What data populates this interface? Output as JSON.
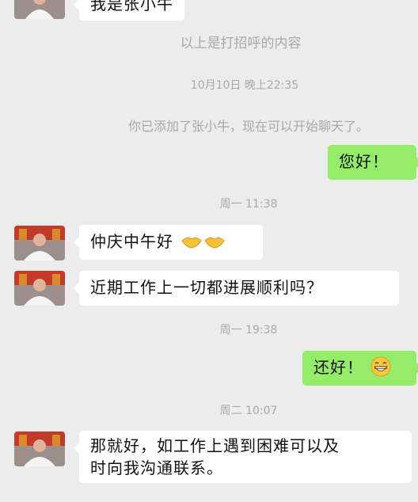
{
  "messages": {
    "m0": "我是张小牛",
    "sys_greeting": "以上是打招呼的内容",
    "time1": "10月10日 晚上22:35",
    "sys_added": "你已添加了张小牛，现在可以开始聊天了。",
    "m1": "您好！",
    "time2": "周一 11:38",
    "m2": "仲庆中午好",
    "m2_emoji": "handshake-emoji",
    "m3": "近期工作上一切都进展顺利吗？",
    "time3": "周一 19:38",
    "m4": "还好！",
    "m4_emoji": "grinning-face-emoji",
    "time4": "周二 10:07",
    "m5_line1": "那就好，如工作上遇到困难可以及",
    "m5_line2": "时向我沟通联系。"
  },
  "colors": {
    "background": "#ececec",
    "bubble_in": "#ffffff",
    "bubble_out": "#95ec69",
    "system_text": "#a9a9a9"
  }
}
